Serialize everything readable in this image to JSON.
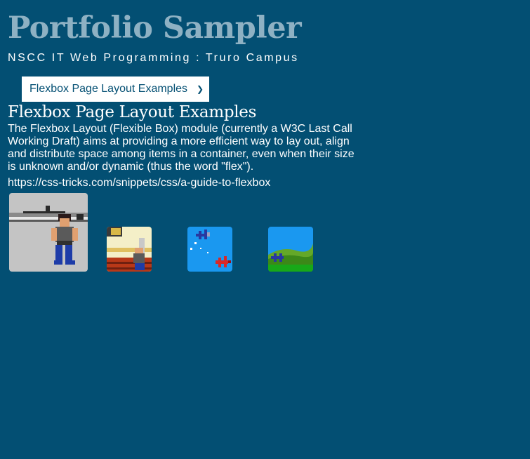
{
  "header": {
    "title": "Portfolio Sampler",
    "subtitle": "NSCC IT Web Programming : Truro Campus"
  },
  "nav": {
    "select_value": "Flexbox Page Layout Examples",
    "chevron_icon": "chevron-down-icon"
  },
  "main": {
    "heading": "Flexbox Page Layout Examples",
    "description": "The Flexbox Layout (Flexible Box) module (currently a W3C Last Call Working Draft) aims at providing a more efficient way to lay out, align and distribute space among items in a container, even when their size is unknown and/or dynamic (thus the word \"flex\").",
    "link": "https://css-tricks.com/snippets/css/a-guide-to-flexbox"
  },
  "gallery": {
    "items": [
      {
        "name": "brawler-on-rooftop"
      },
      {
        "name": "brawler-indoors"
      },
      {
        "name": "biplanes-in-sky"
      },
      {
        "name": "biplane-over-hills"
      }
    ]
  },
  "colors": {
    "background": "#034f73",
    "title": "#8eb1c3",
    "text": "#ffffff"
  }
}
